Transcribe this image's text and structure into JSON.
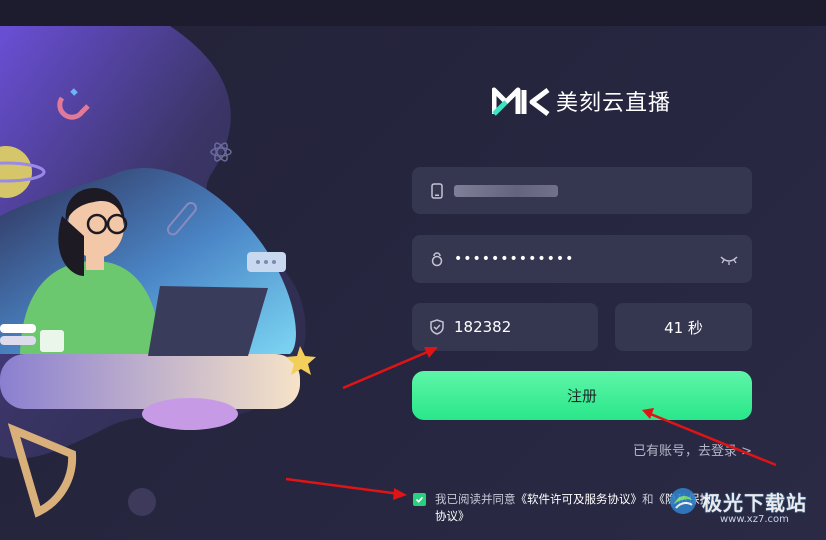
{
  "brand": {
    "name": "美刻云直播",
    "logo": "MK-logo"
  },
  "form": {
    "phone": {
      "icon": "phone-icon",
      "value_masked": true
    },
    "password": {
      "icon": "lock-icon",
      "dots": "•••••••••••••",
      "toggle_icon": "eye-closed-icon"
    },
    "code": {
      "icon": "shield-icon",
      "value": "182382"
    },
    "countdown": "41 秒",
    "register_label": "注册",
    "login_link": "已有账号，去登录 >"
  },
  "agreement": {
    "checked": true,
    "prefix": "我已阅读并同意",
    "license_link": "《软件许可及服务协议》",
    "and": "和",
    "privacy_link": "《隐私保护协议》"
  },
  "watermark": {
    "text": "极光下载站",
    "url": "www.xz7.com"
  },
  "colors": {
    "background": "#23233a",
    "field": "#35364f",
    "accent": "#29e78a",
    "annotation_arrow": "#e01414"
  }
}
